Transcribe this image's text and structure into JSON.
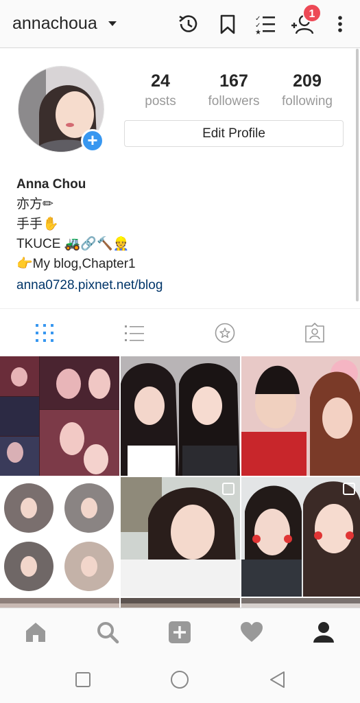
{
  "header": {
    "username": "annachoua",
    "notification_count": "1"
  },
  "profile": {
    "posts_count": "24",
    "posts_label": "posts",
    "followers_count": "167",
    "followers_label": "followers",
    "following_count": "209",
    "following_label": "following",
    "edit_button": "Edit Profile"
  },
  "bio": {
    "name": "Anna Chou",
    "line1": "亦方✏",
    "line2": "手手✋",
    "line3": "TKUCE 🚜🔗🔨👷",
    "line4": "👉My blog,Chapter1",
    "link": "anna0728.pixnet.net/blog"
  },
  "colors": {
    "accent": "#3897f0",
    "badge": "#ed4956",
    "link": "#003569"
  },
  "icons": {
    "activity": "history-icon",
    "saved": "bookmark-icon",
    "close_friends": "list-star-icon",
    "discover": "add-person-icon",
    "menu": "more-vertical-icon"
  },
  "tabs": [
    "grid-icon",
    "list-icon",
    "tagged-star-icon",
    "tagged-person-icon"
  ],
  "bottom_nav": [
    "home-icon",
    "search-icon",
    "add-post-icon",
    "heart-icon",
    "profile-icon"
  ],
  "system_nav": [
    "recents-icon",
    "home-circle-icon",
    "back-icon"
  ]
}
